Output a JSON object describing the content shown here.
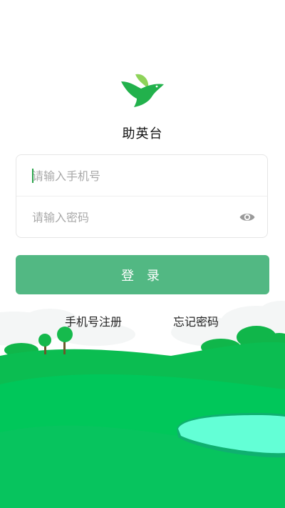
{
  "app": {
    "name": "助英台"
  },
  "login_form": {
    "phone_placeholder": "请输入手机号",
    "password_placeholder": "请输入密码"
  },
  "login_button_label": "登 录",
  "links": {
    "register": "手机号注册",
    "forgot_password": "忘记密码"
  },
  "icons": {
    "logo": "bird-logo-icon",
    "password_toggle": "eye-icon"
  },
  "colors": {
    "brand_green": "#22b14c",
    "button_green": "#52b883",
    "hill_green": "#02c85e",
    "lake_teal": "#63ffd6"
  }
}
